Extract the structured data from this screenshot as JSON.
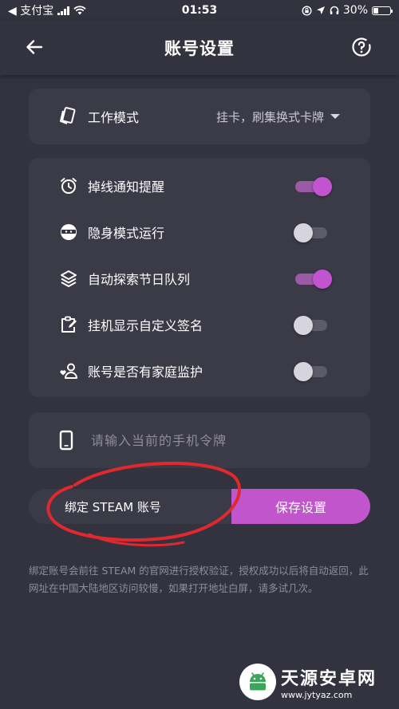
{
  "status_bar": {
    "carrier": "◀ 支付宝",
    "time": "01:53",
    "battery": "30%",
    "battery_level": 0.3
  },
  "header": {
    "title": "账号设置",
    "back_icon": "arrow-left-icon",
    "help_icon": "help-circle-icon"
  },
  "mode": {
    "label": "工作模式",
    "value": "挂卡，刷集换式卡牌",
    "icon": "cards-icon"
  },
  "toggles": [
    {
      "label": "掉线通知提醒",
      "on": true,
      "icon": "alarm-clock-icon"
    },
    {
      "label": "隐身模式运行",
      "on": false,
      "icon": "ninja-icon"
    },
    {
      "label": "自动探索节日队列",
      "on": true,
      "icon": "layers-icon"
    },
    {
      "label": "挂机显示自定义签名",
      "on": false,
      "icon": "clipboard-edit-icon"
    },
    {
      "label": "账号是否有家庭监护",
      "on": false,
      "icon": "family-guard-icon"
    }
  ],
  "token": {
    "placeholder": "请输入当前的手机令牌",
    "value": "",
    "icon": "phone-icon"
  },
  "actions": {
    "bind_label": "绑定 STEAM 账号",
    "save_label": "保存设置"
  },
  "note": "绑定账号会前往 STEAM 的官网进行授权验证，授权成功以后将自动返回，此网址在中国大陆地区访问较慢，如果打开地址白屏，请多试几次。",
  "watermark": {
    "name": "天源安卓网",
    "url": "www.jytyaz.com"
  },
  "colors": {
    "background": "#33323f",
    "card": "#3b3a47",
    "accent": "#c055cc",
    "toggle_on_knob": "#c254d0",
    "toggle_on_track": "#9b5aa6",
    "toggle_off_knob": "#d6d5dd",
    "annotation": "#e0292e"
  }
}
